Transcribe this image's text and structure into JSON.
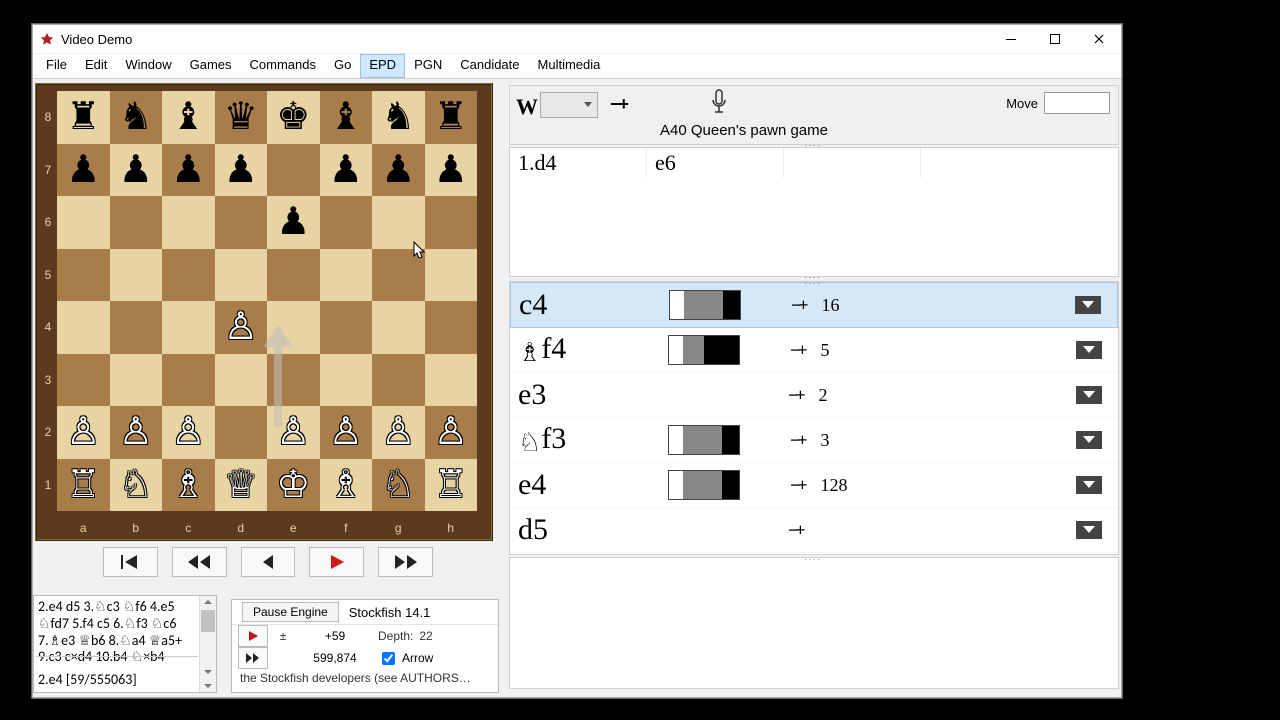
{
  "window": {
    "title": "Video Demo"
  },
  "menu": [
    "File",
    "Edit",
    "Window",
    "Games",
    "Commands",
    "Go",
    "EPD",
    "PGN",
    "Candidate",
    "Multimedia"
  ],
  "menu_active": "EPD",
  "board": {
    "ranks": [
      "8",
      "7",
      "6",
      "5",
      "4",
      "3",
      "2",
      "1"
    ],
    "files": [
      "a",
      "b",
      "c",
      "d",
      "e",
      "f",
      "g",
      "h"
    ],
    "pieces": [
      [
        "r",
        "n",
        "b",
        "q",
        "k",
        "b",
        "n",
        "r"
      ],
      [
        "p",
        "p",
        "p",
        "p",
        "",
        "p",
        "p",
        "p"
      ],
      [
        "",
        "",
        "",
        "",
        "p",
        "",
        "",
        ""
      ],
      [
        "",
        "",
        "",
        "",
        "",
        "",
        "",
        ""
      ],
      [
        "",
        "",
        "",
        "P",
        "",
        "",
        "",
        ""
      ],
      [
        "",
        "",
        "",
        "",
        "",
        "",
        "",
        ""
      ],
      [
        "P",
        "P",
        "P",
        "",
        "P",
        "P",
        "P",
        "P"
      ],
      [
        "R",
        "N",
        "B",
        "Q",
        "K",
        "B",
        "N",
        "R"
      ]
    ]
  },
  "nav": {
    "first": "|◀",
    "prev": "◀◀",
    "back": "◀",
    "play": "▶",
    "fwd": "▶▶"
  },
  "header": {
    "turn": "W",
    "addplus": "−+",
    "move_label": "Move",
    "opening": "A40  Queen's pawn game"
  },
  "moves": {
    "num": "1.",
    "white": "d4",
    "black": "e6"
  },
  "candidates": [
    {
      "move": "c4",
      "piece": "",
      "bar": [
        20,
        55,
        25
      ],
      "score": "16",
      "selected": true
    },
    {
      "move": "f4",
      "piece": "♗",
      "bar": [
        20,
        30,
        50
      ],
      "score": "5",
      "selected": false
    },
    {
      "move": "e3",
      "piece": "",
      "bar": null,
      "score": "2",
      "selected": false
    },
    {
      "move": "f3",
      "piece": "♘",
      "bar": [
        20,
        55,
        25
      ],
      "score": "3",
      "selected": false
    },
    {
      "move": "e4",
      "piece": "",
      "bar": [
        20,
        55,
        25
      ],
      "score": "128",
      "selected": false
    },
    {
      "move": "d5",
      "piece": "",
      "bar": null,
      "score": "",
      "selected": false
    }
  ],
  "pv": {
    "line1": "2.e4 d5 3.♘c3 ♘f6 4.e5",
    "line2": "♘fd7 5.f4 c5 6.♘f3 ♘c6",
    "line3": "7.♗e3 ♕b6 8.♘a4 ♕a5+",
    "line4": "9.c3 c×d4 10.b4 ♘×b4",
    "summary": "2.e4 [59/555063]"
  },
  "engine": {
    "pause": "Pause Engine",
    "name": "Stockfish 14.1",
    "score": "+59",
    "depth_label": "Depth:",
    "depth": "22",
    "nodes": "599,874",
    "arrow_label": "Arrow",
    "credit": "the Stockfish developers (see AUTHORS…"
  }
}
